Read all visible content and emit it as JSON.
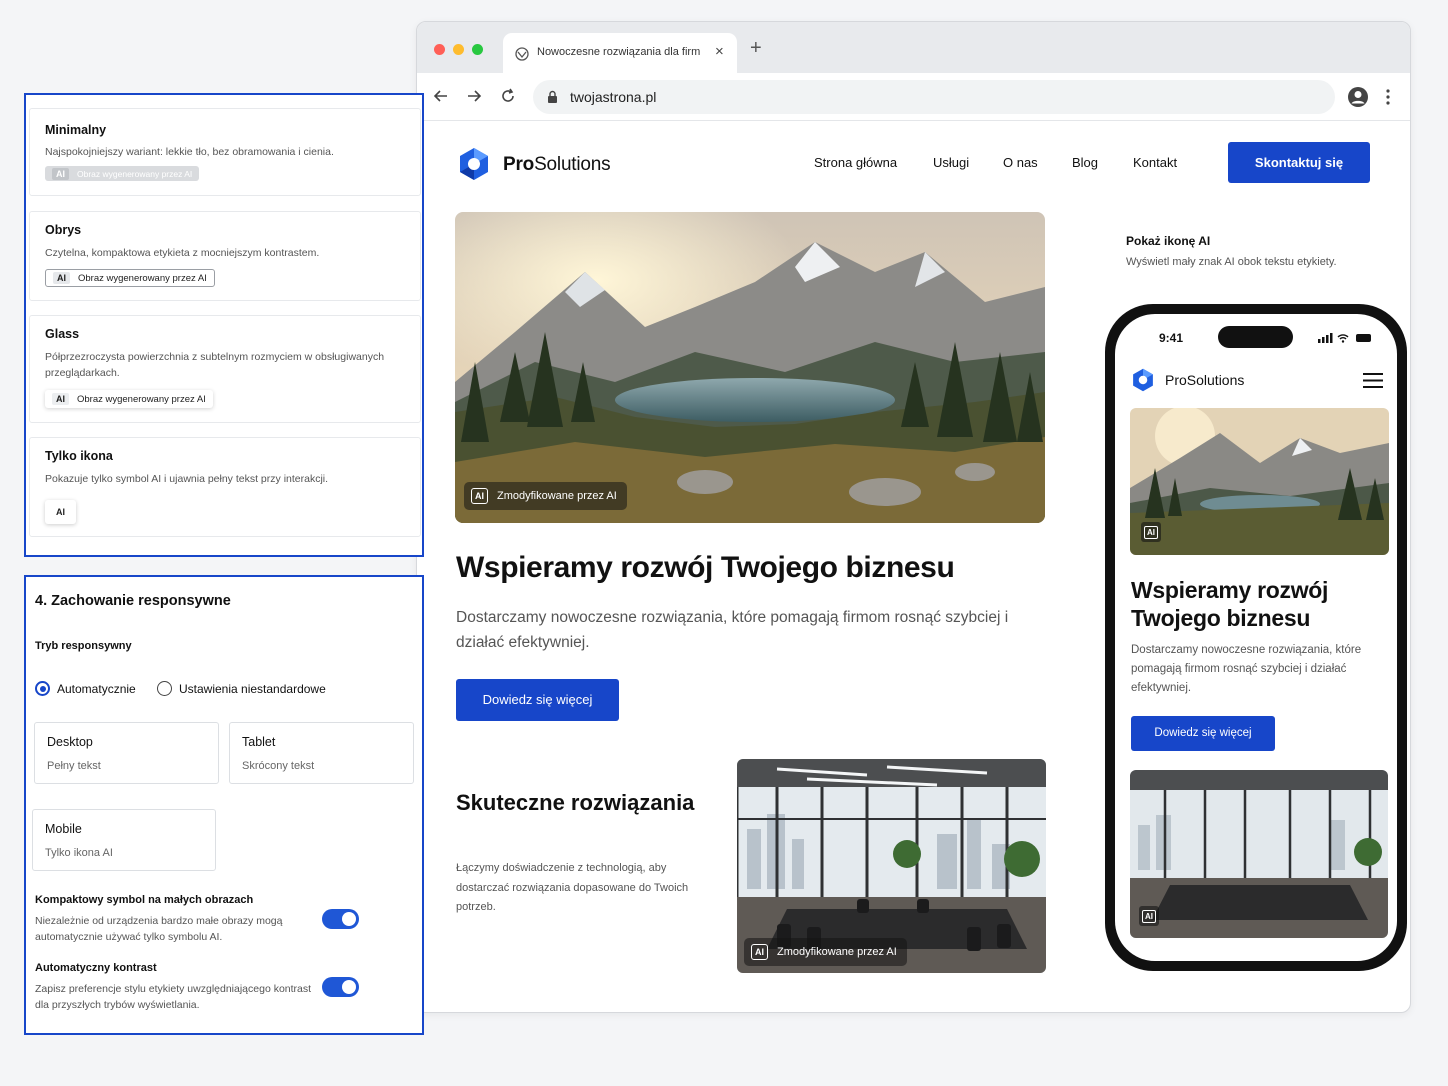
{
  "browser": {
    "tab_title": "Nowoczesne rozwiązania dla firm",
    "url": "twojastrona.pl",
    "traffic_lights": [
      "#ff5f57",
      "#febc2e",
      "#28c840"
    ]
  },
  "site": {
    "brand_prefix": "Pro",
    "brand_suffix": "Solutions",
    "nav": [
      "Strona główna",
      "Usługi",
      "O nas",
      "Blog",
      "Kontakt"
    ],
    "cta": "Skontaktuj się",
    "hero_badge": "Zmodyfikowane przez AI",
    "hero_badge_icon": "AI",
    "headline": "Wspieramy rozwój Twojego biznesu",
    "lead": "Dostarczamy nowoczesne rozwiązania, które pomagają firmom rosnąć szybciej i działać efektywniej.",
    "more_button": "Dowiedz się więcej",
    "section_title": "Skuteczne rozwiązania",
    "section_text": "Łączymy doświadczenie z technologią, aby dostarczać rozwiązania dopasowane do Twoich potrzeb.",
    "office_badge": "Zmodyfikowane przez AI",
    "accent": "#1746c9"
  },
  "side_option": {
    "title": "Pokaż ikonę AI",
    "desc": "Wyświetl mały znak AI obok tekstu etykiety."
  },
  "phone": {
    "time": "9:41",
    "brand": "ProSolutions",
    "headline": "Wspieramy rozwój Twojego biznesu",
    "text": "Dostarczamy nowoczesne rozwiązania, które pomagają firmom rosnąć szybciej i działać efektywniej.",
    "button": "Dowiedz się więcej",
    "ai_icon": "AI"
  },
  "styles_panel": {
    "label_text": "Obraz wygenerowany przez AI",
    "ai_text": "AI",
    "cards": [
      {
        "title": "Minimalny",
        "desc": "Najspokojniejszy wariant: lekkie tło, bez obramowania i cienia."
      },
      {
        "title": "Obrys",
        "desc": "Czytelna, kompaktowa etykieta z mocniejszym kontrastem."
      },
      {
        "title": "Glass",
        "desc": "Półprzezroczysta powierzchnia z subtelnym rozmyciem w obsługiwanych przeglądarkach."
      },
      {
        "title": "Tylko ikona",
        "desc": "Pokazuje tylko symbol AI i ujawnia pełny tekst przy interakcji."
      }
    ]
  },
  "responsive_panel": {
    "heading": "4. Zachowanie responsywne",
    "mode_label": "Tryb responsywny",
    "radio_auto": "Automatycznie",
    "radio_custom": "Ustawienia niestandardowe",
    "devices": [
      {
        "name": "Desktop",
        "value": "Pełny tekst"
      },
      {
        "name": "Tablet",
        "value": "Skrócony tekst"
      },
      {
        "name": "Mobile",
        "value": "Tylko ikona AI"
      }
    ],
    "toggle1_title": "Kompaktowy symbol na małych obrazach",
    "toggle1_desc": "Niezależnie od urządzenia bardzo małe obrazy mogą automatycznie używać tylko symbolu AI.",
    "toggle2_title": "Automatyczny kontrast",
    "toggle2_desc": "Zapisz preferencje stylu etykiety uwzględniającego kontrast dla przyszłych trybów wyświetlania."
  }
}
